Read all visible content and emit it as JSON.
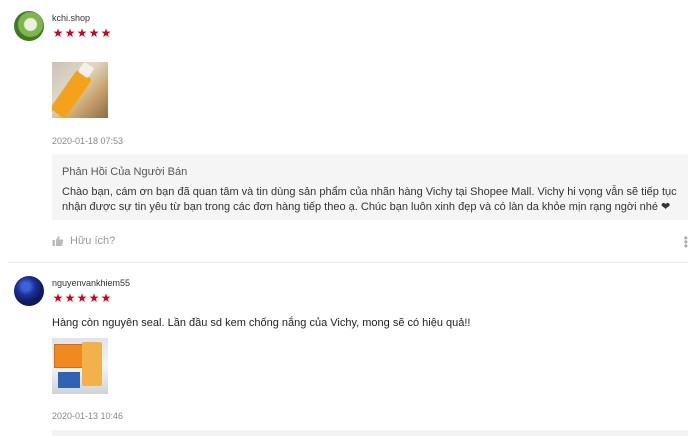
{
  "reviews": [
    {
      "username": "kchi.shop",
      "rating": 5,
      "stars": [
        "★",
        "★",
        "★",
        "★",
        "★"
      ],
      "date": "2020-01-18 07:53",
      "image_desc_icon": "product-photo",
      "seller_reply": {
        "title": "Phản Hồi Của Người Bán",
        "text": "Chào bạn, cám ơn bạn đã quan tâm và tin dùng sản phẩm của nhãn hàng Vichy tại Shopee Mall. Vichy hi vọng vẫn sẽ tiếp tục nhận được sự tin yêu từ bạn trong các đơn hàng tiếp theo ạ. Chúc bạn luôn xinh đẹp và có làn da khỏe mịn rạng ngời nhé ❤"
      },
      "helpful_label": "Hữu ích?"
    },
    {
      "username": "nguyenvankhiem55",
      "rating": 5,
      "stars": [
        "★",
        "★",
        "★",
        "★",
        "★"
      ],
      "comment": "Hàng còn nguyên seal. Lần đầu sd kem chống nắng của Vichy, mong sẽ có hiệu quả!!",
      "date": "2020-01-13 10:46"
    }
  ],
  "colors": {
    "star": "#d0011b",
    "reply_bg": "#f5f5f5"
  },
  "icons": {
    "helpful": "thumbs-up-icon",
    "more": "more-vertical-icon"
  }
}
